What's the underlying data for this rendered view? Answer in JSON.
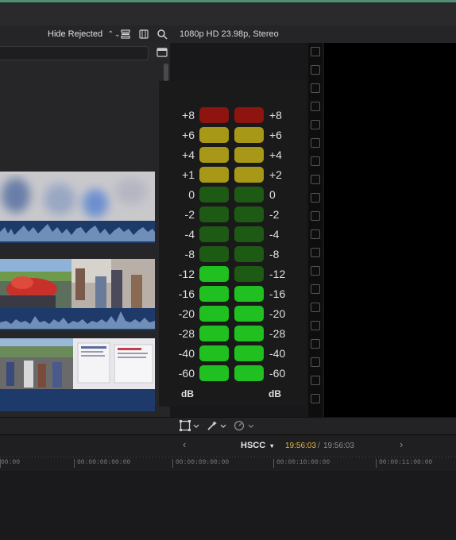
{
  "browser_toolbar": {
    "filter_label": "Hide Rejected"
  },
  "viewer": {
    "format_label": "1080p HD 23.98p, Stereo"
  },
  "audio_meters": {
    "left_labels": [
      "+8",
      "+6",
      "+4",
      "+1",
      "0",
      "-2",
      "-4",
      "-8",
      "-12",
      "-16",
      "-20",
      "-28",
      "-40",
      "-60"
    ],
    "right_labels": [
      "+8",
      "+6",
      "+4",
      "+2",
      "0",
      "-2",
      "-4",
      "-8",
      "-12",
      "-16",
      "-20",
      "-28",
      "-40",
      "-60"
    ],
    "db_left": "dB",
    "db_right": "dB",
    "colors": {
      "red": "#8e1410",
      "yellow": "#a89818",
      "dark_green": "#1d5a14",
      "bright_green": "#20c020"
    },
    "left_segments": [
      "red",
      "yellow",
      "yellow",
      "yellow",
      "dark_green",
      "dark_green",
      "dark_green",
      "dark_green",
      "bright_green",
      "bright_green",
      "bright_green",
      "bright_green",
      "bright_green",
      "bright_green"
    ],
    "right_segments": [
      "red",
      "yellow",
      "yellow",
      "yellow",
      "dark_green",
      "dark_green",
      "dark_green",
      "dark_green",
      "dark_green",
      "bright_green",
      "bright_green",
      "bright_green",
      "bright_green",
      "bright_green"
    ]
  },
  "timeline_nav": {
    "prev": "‹",
    "project": "HSCC",
    "current_timecode": "19:56:03",
    "separator": "/",
    "total_timecode": "19:56:03",
    "next": "›"
  },
  "ruler": {
    "ticks": [
      "00:00",
      "00:00:08:00:00",
      "00:00:09:00:00",
      "00:00:10:00:00",
      "00:00:11:00:00"
    ]
  }
}
